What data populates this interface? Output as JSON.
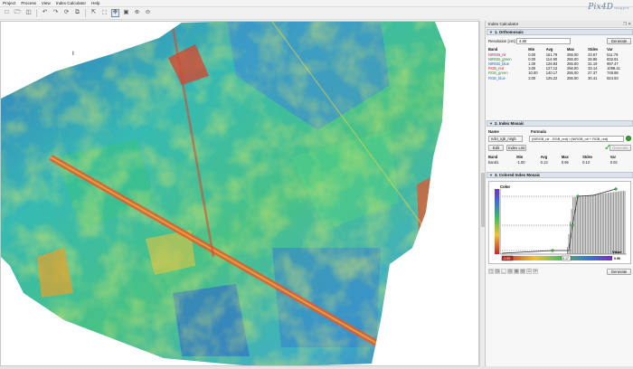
{
  "menu": [
    "Project",
    "Process",
    "View",
    "Index Calculator",
    "Help"
  ],
  "toolbar_icons": [
    "new-icon",
    "open-icon",
    "save-icon",
    "undo-icon",
    "redo-icon",
    "rotate-icon",
    "copy-icon",
    "export-icon",
    "select-icon",
    "pan-icon",
    "zoom-extent-icon",
    "zoom-in-icon",
    "zoom-out-icon"
  ],
  "panel": {
    "title": "Index Calculator",
    "window_controls": "❐ ✕",
    "logo": "Pix4D",
    "logo_sub": "mapper",
    "orthomosaic": {
      "section": "1. Orthomosaic",
      "resolution_label": "Resolution [cm]:",
      "resolution_value": "4.86",
      "generate": "Generate",
      "headers": [
        "Band",
        "Min",
        "Avg",
        "Max",
        "Stdev",
        "Var"
      ],
      "rows": [
        {
          "band": "NIRGB_nir",
          "color": "#c2185b",
          "min": "0.00",
          "avg": "161.79",
          "max": "255.00",
          "stdev": "23.67",
          "var": "511.79"
        },
        {
          "band": "NIRGB_green",
          "color": "#2e7d32",
          "min": "0.00",
          "avg": "114.90",
          "max": "255.00",
          "stdev": "28.86",
          "var": "832.91"
        },
        {
          "band": "NIRGB_blue",
          "color": "#1565c0",
          "min": "1.00",
          "avg": "126.93",
          "max": "255.00",
          "stdev": "31.19",
          "var": "997.47"
        },
        {
          "band": "RGB_red",
          "color": "#c62828",
          "min": "3.00",
          "avg": "127.12",
          "max": "256.00",
          "stdev": "33.14",
          "var": "1098.41"
        },
        {
          "band": "RGB_green",
          "color": "#388e3c",
          "min": "10.00",
          "avg": "140.17",
          "max": "255.00",
          "stdev": "27.37",
          "var": "748.88"
        },
        {
          "band": "RGB_blue",
          "color": "#1976d2",
          "min": "3.00",
          "avg": "125.22",
          "max": "255.00",
          "stdev": "30.41",
          "var": "924.93"
        }
      ]
    },
    "index_mosaic": {
      "section": "2. Index Mosaic",
      "name_label": "Name",
      "formula_label": "Formula",
      "name_value": "ndvi_rgb_nirgb",
      "formula_value": "(NIRGB_nir - RGB_red) / (NIRGB_nir + RGB_red)",
      "edit": "Edit",
      "index_list": "Index List",
      "generate": "Generate",
      "headers": [
        "Band",
        "Min",
        "Avg",
        "Max",
        "Stdev",
        "Var"
      ],
      "row": {
        "band": "band1",
        "min": "-1.00",
        "avg": "0.13",
        "max": "0.96",
        "stdev": "0.13",
        "var": "0.02"
      }
    },
    "colored_index": {
      "section": "3. Colored Index Mosaic",
      "color_axis": "Color",
      "value_axis": "Value",
      "min_label": "-1.00",
      "mid_label": "0.17",
      "max_label": "0.96",
      "generate": "Generate"
    }
  }
}
